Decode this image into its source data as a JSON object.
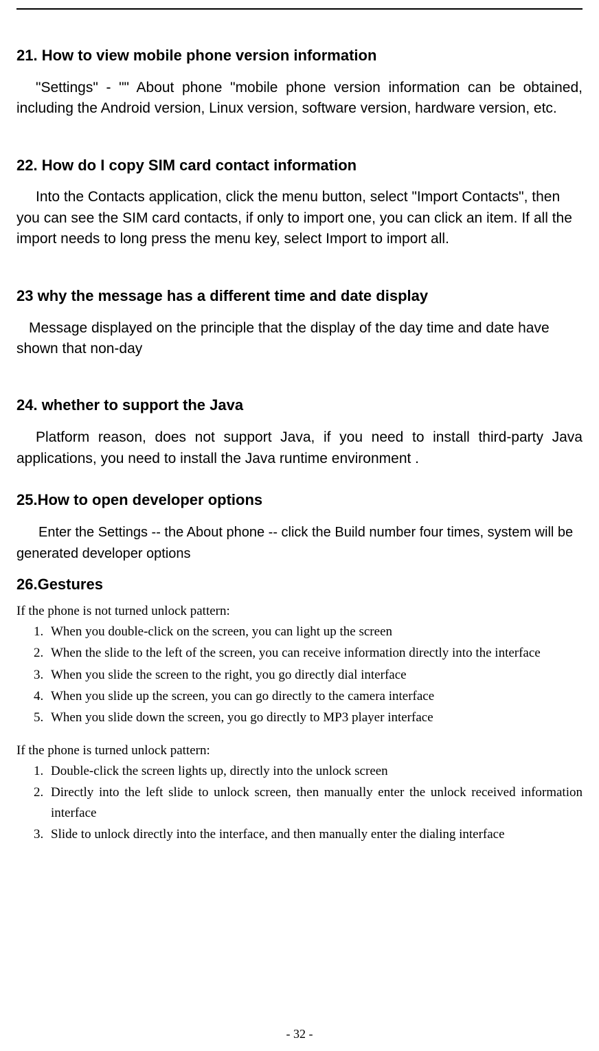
{
  "sections": {
    "s21": {
      "heading": "21. How to view mobile phone version information",
      "body": "\"Settings\" - \"\" About phone \"mobile phone version information can be obtained, including the Android version, Linux version, software version, hardware version, etc."
    },
    "s22": {
      "heading": "22. How do I copy SIM card contact information",
      "body": "Into the Contacts application, click the menu button, select \"Import Contacts\", then you can see the SIM card contacts, if only to import one, you can click an item. If all the import needs to long press the menu key, select Import to import all."
    },
    "s23": {
      "heading": "23 why the message has a different time and date display",
      "body": "Message displayed on the principle that the display of the day time and date have shown that non-day"
    },
    "s24": {
      "heading": "24.   whether to support the Java",
      "body": "Platform reason,   does not support Java, if you need to install third-party Java applications, you need to install the Java runtime environment ."
    },
    "s25": {
      "heading": "25.How to open developer options",
      "body": "Enter the Settings -- the About phone -- click the Build number four times, system will be generated developer options"
    },
    "s26": {
      "heading": "26.Gestures",
      "intro1": "If the phone is not turned unlock pattern:",
      "list1": [
        "When you double-click on the screen, you can light up the screen",
        "When the slide to the left of the screen, you can receive information directly into the interface",
        "When you slide the screen to the right, you go directly dial interface",
        "When you slide up the screen, you can go directly to the camera interface",
        "When you slide down the screen, you go directly to MP3 player interface"
      ],
      "intro2": "If the phone is turned unlock pattern:",
      "list2": [
        "Double-click the screen lights up, directly into the unlock screen",
        "Directly into the left slide to unlock screen, then manually enter the unlock received information interface",
        "Slide to unlock directly into the interface, and then manually enter the dialing interface"
      ]
    }
  },
  "pageNumber": "- 32 -"
}
